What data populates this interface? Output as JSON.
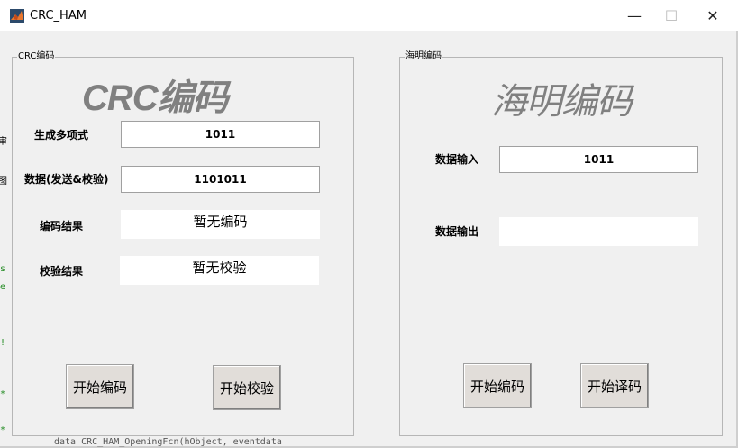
{
  "window": {
    "title": "CRC_HAM",
    "minimize_glyph": "—",
    "maximize_glyph": "☐",
    "close_glyph": "✕"
  },
  "background_editor": {
    "left_glyphs": [
      "审",
      "图",
      "s",
      "e",
      "!",
      "*",
      "*"
    ],
    "bottom_text": "data CRC_HAM_OpeningFcn(hObject, eventdata"
  },
  "crc_panel": {
    "legend": "CRC编码",
    "heading": "CRC编码",
    "polynomial_label": "生成多项式",
    "polynomial_value": "1011",
    "data_label": "数据(发送&校验)",
    "data_value": "1101011",
    "encode_result_label": "编码结果",
    "encode_result_value": "暂无编码",
    "check_result_label": "校验结果",
    "check_result_value": "暂无校验",
    "encode_button": "开始编码",
    "check_button": "开始校验"
  },
  "hamming_panel": {
    "legend": "海明编码",
    "heading": "海明编码",
    "input_label": "数据输入",
    "input_value": "1011",
    "output_label": "数据输出",
    "output_value": "",
    "encode_button": "开始编码",
    "decode_button": "开始译码"
  }
}
